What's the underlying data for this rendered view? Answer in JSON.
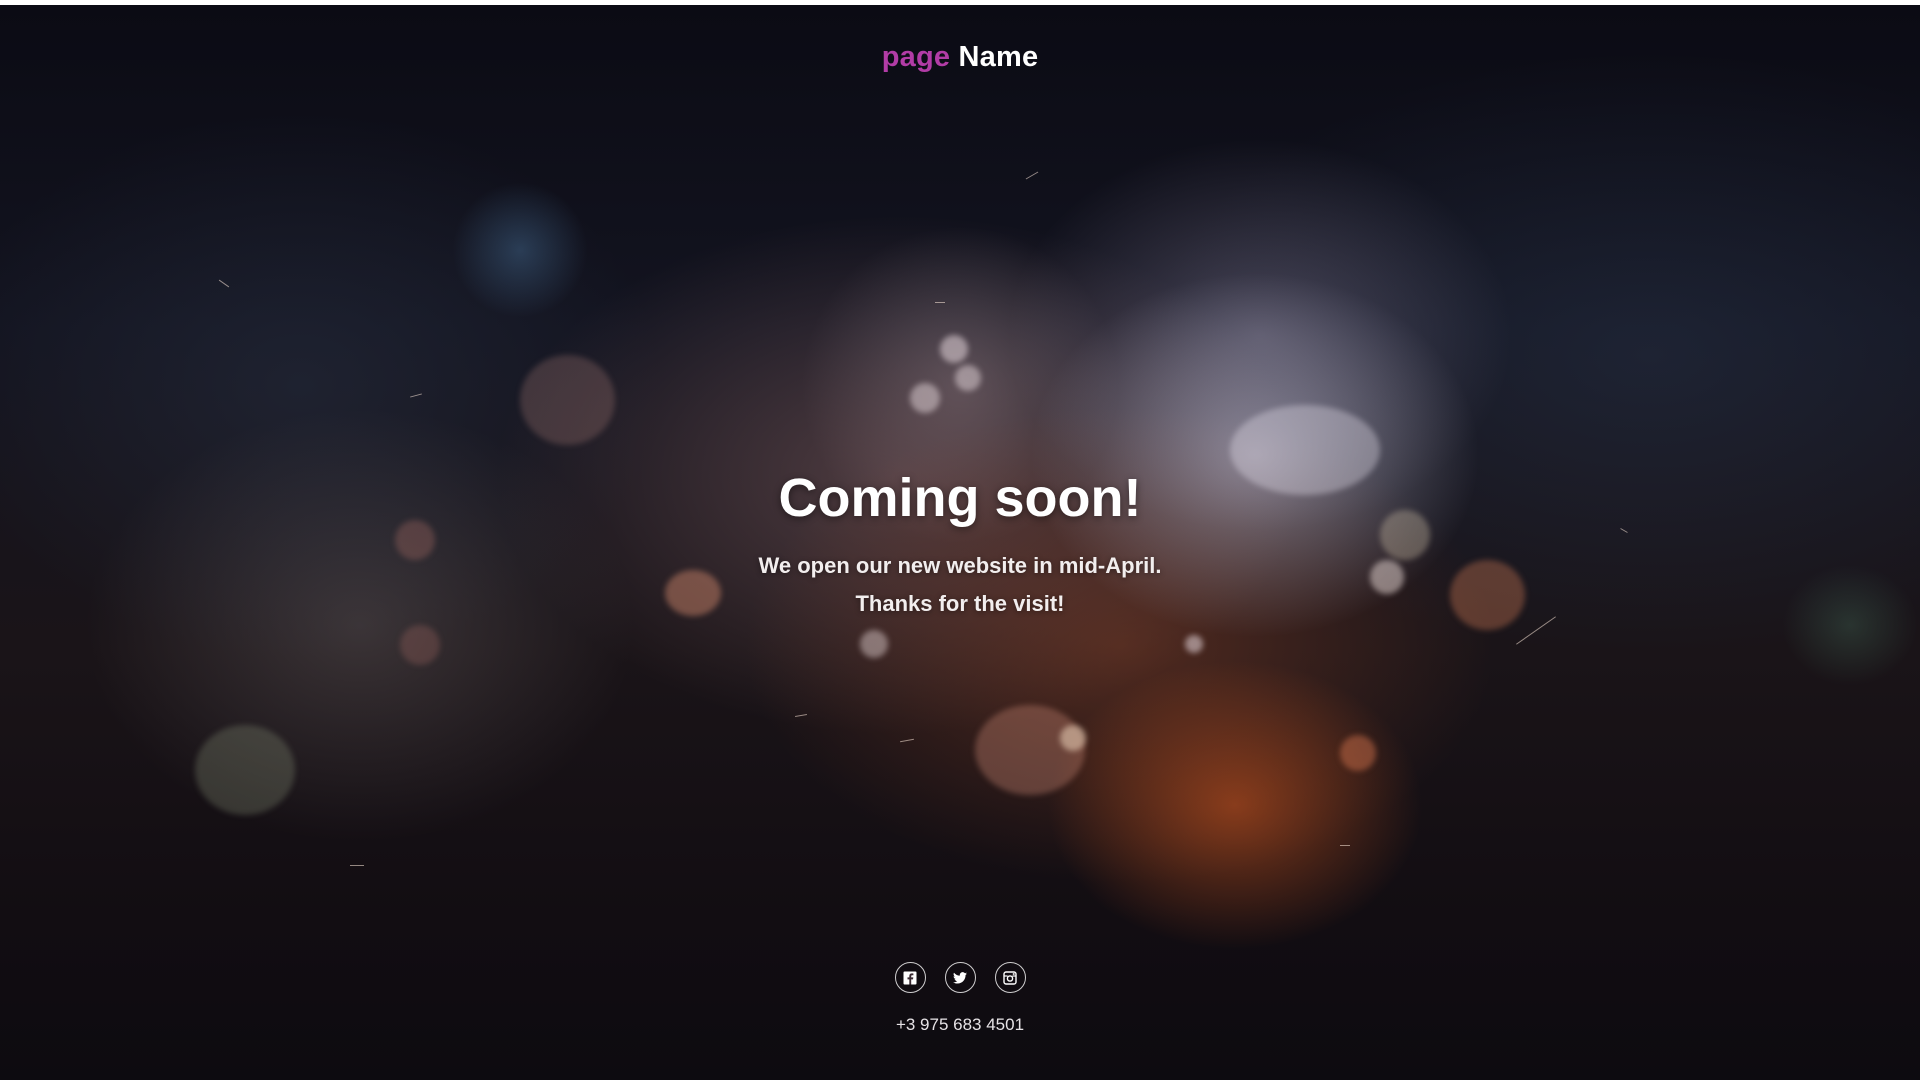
{
  "header": {
    "logo_part1": "page",
    "logo_part2": "Name",
    "logo_accent_color": "#b23ca6"
  },
  "hero": {
    "title": "Coming soon!",
    "line1": "We open our new website in mid-April.",
    "line2": "Thanks for the visit!"
  },
  "footer": {
    "social": [
      {
        "name": "facebook",
        "icon": "facebook-icon"
      },
      {
        "name": "twitter",
        "icon": "twitter-icon"
      },
      {
        "name": "instagram",
        "icon": "instagram-icon"
      }
    ],
    "phone": "+3 975 683 4501"
  }
}
